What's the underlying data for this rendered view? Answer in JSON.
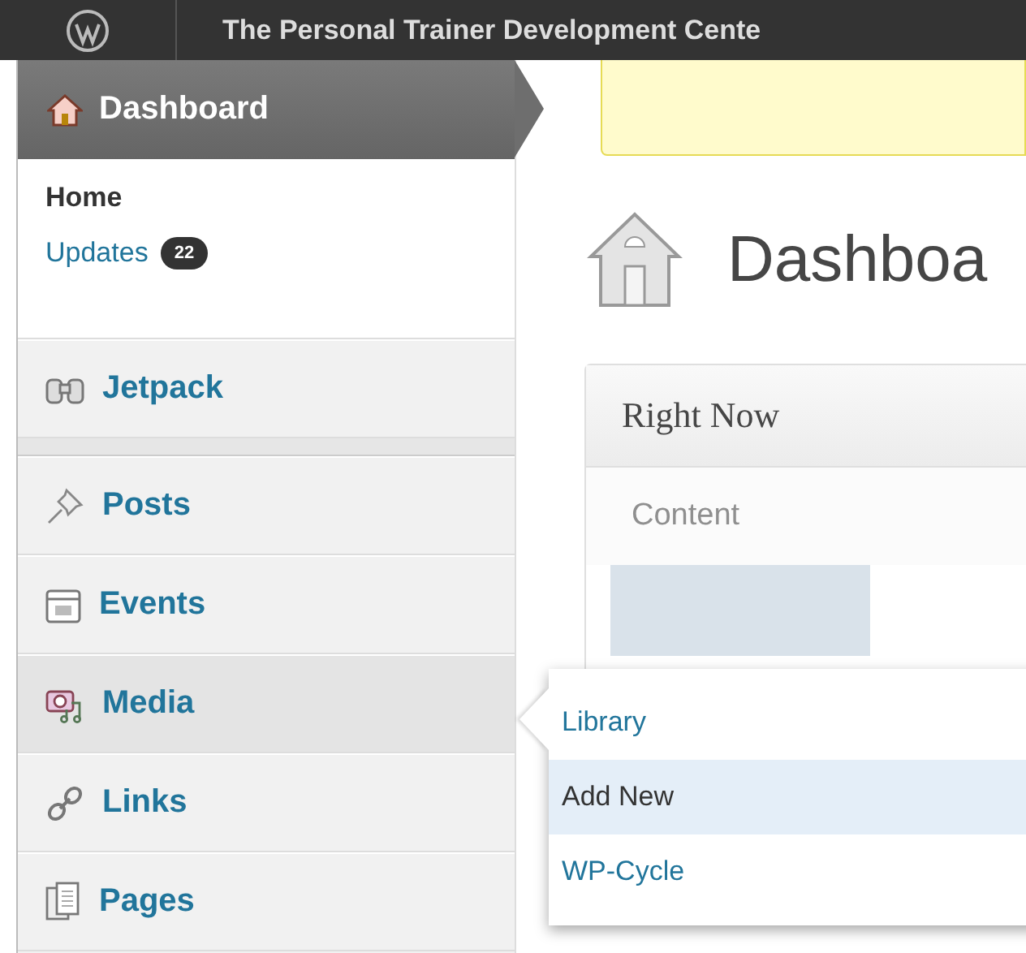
{
  "admin_bar": {
    "site_title": "The Personal Trainer Development Cente"
  },
  "menu": [
    {
      "kind": "current",
      "label": "Dashboard",
      "submenu": [
        {
          "label": "Home",
          "selected": true
        },
        {
          "label": "Updates",
          "badge": "22",
          "selected": false
        }
      ]
    },
    {
      "kind": "item",
      "label": "Jetpack",
      "hovered": false
    },
    {
      "kind": "separator"
    },
    {
      "kind": "item",
      "label": "Posts",
      "hovered": false
    },
    {
      "kind": "item",
      "label": "Events",
      "hovered": false
    },
    {
      "kind": "item",
      "label": "Media",
      "hovered": true
    },
    {
      "kind": "item",
      "label": "Links",
      "hovered": false
    },
    {
      "kind": "item",
      "label": "Pages",
      "hovered": false
    }
  ],
  "page": {
    "title": "Dashboa"
  },
  "widget": {
    "title": "Right Now",
    "section": "Content"
  },
  "flyout": {
    "items": [
      {
        "label": "Library",
        "selected": false
      },
      {
        "label": "Add New",
        "selected": true
      },
      {
        "label": "WP-Cycle",
        "selected": false
      }
    ]
  }
}
